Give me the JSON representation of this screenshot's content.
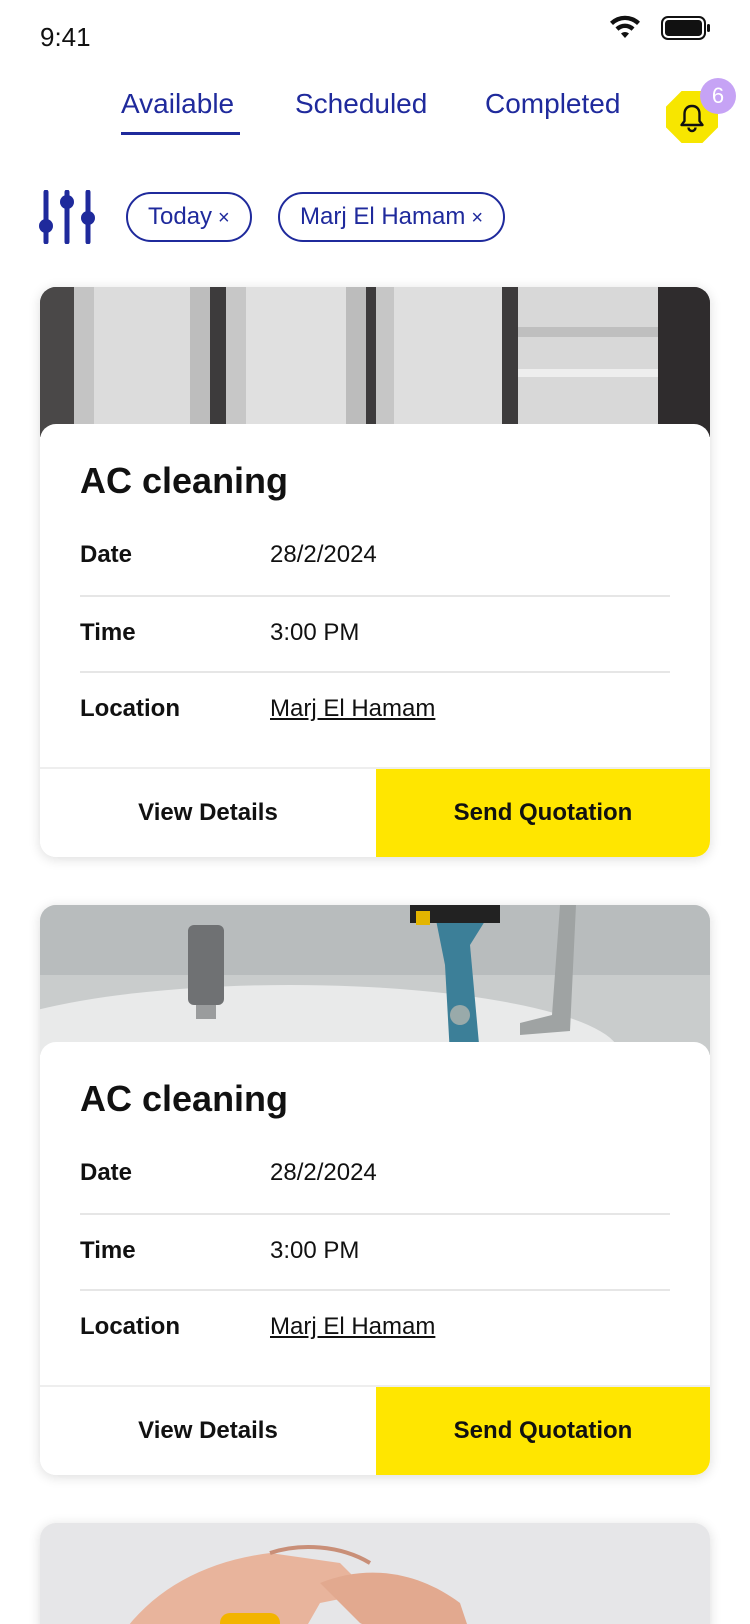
{
  "status_bar": {
    "time": "9:41",
    "wifi_icon": "wifi-icon",
    "battery_icon": "battery-icon"
  },
  "tabs": [
    {
      "label": "Available",
      "active": true
    },
    {
      "label": "Scheduled",
      "active": false
    },
    {
      "label": "Completed",
      "active": false
    }
  ],
  "notifications": {
    "icon": "bell-icon",
    "count": "6",
    "badge_color": "#c6a3f5",
    "icon_bg_color": "#f7e600"
  },
  "filters": {
    "icon": "sliders-icon",
    "chips": [
      {
        "label": "Today",
        "remove_symbol": "×"
      },
      {
        "label": "Marj El Hamam",
        "remove_symbol": "×"
      }
    ]
  },
  "colors": {
    "accent": "#1f2a9c",
    "primary_button": "#ffe600"
  },
  "jobs": [
    {
      "image": "radiator-photo",
      "title": "AC cleaning",
      "rows": [
        {
          "label": "Date",
          "value": "28/2/2024"
        },
        {
          "label": "Time",
          "value": "3:00 PM"
        },
        {
          "label": "Location",
          "value": "Marj El Hamam"
        }
      ],
      "view_details_label": "View Details",
      "send_quotation_label": "Send Quotation"
    },
    {
      "image": "water-heater-wrench-photo",
      "title": "AC cleaning",
      "rows": [
        {
          "label": "Date",
          "value": "28/2/2024"
        },
        {
          "label": "Time",
          "value": "3:00 PM"
        },
        {
          "label": "Location",
          "value": "Marj El Hamam"
        }
      ],
      "view_details_label": "View Details",
      "send_quotation_label": "Send Quotation"
    },
    {
      "image": "hands-tool-photo"
    }
  ]
}
